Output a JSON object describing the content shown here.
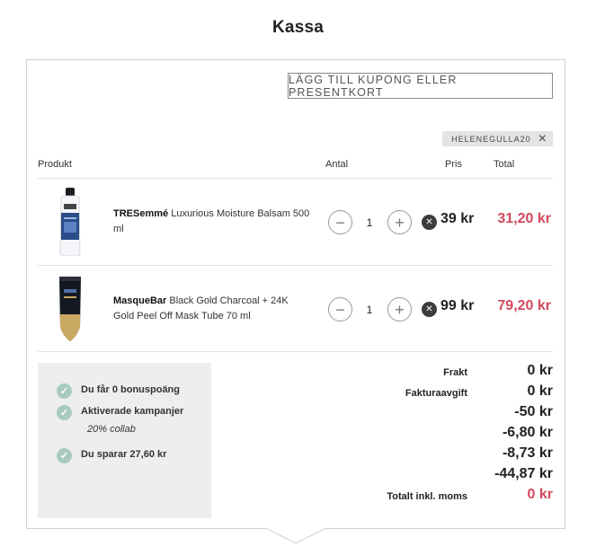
{
  "page": {
    "title": "Kassa"
  },
  "coupon": {
    "button_label": "LÄGG TILL KUPONG ELLER PRESENTKORT",
    "applied_code": "HELENEGULLA20",
    "remove_icon": "close-icon"
  },
  "table": {
    "headers": {
      "product": "Produkt",
      "quantity": "Antal",
      "price": "Pris",
      "total": "Total"
    }
  },
  "items": [
    {
      "brand": "TRESemmé",
      "name": "Luxurious Moisture Balsam 500 ml",
      "quantity": "1",
      "price": "39 kr",
      "total": "31,20 kr",
      "remove_icon": "remove-icon"
    },
    {
      "brand": "MasqueBar",
      "name": "Black Gold Charcoal + 24K Gold Peel Off Mask Tube 70 ml",
      "quantity": "1",
      "price": "99 kr",
      "total": "79,20 kr",
      "remove_icon": "remove-icon"
    }
  ],
  "bonus": {
    "points": "Du får 0 bonuspoäng",
    "campaigns": "Aktiverade kampanjer",
    "campaign_name": "20% collab",
    "savings": "Du sparar 27,60 kr"
  },
  "summary": {
    "shipping_label": "Frakt",
    "shipping_value": "0 kr",
    "invoice_fee_label": "Fakturaavgift",
    "invoice_fee_value": "0 kr",
    "discounts": [
      "-50 kr",
      "-6,80 kr",
      "-8,73 kr",
      "-44,87 kr"
    ],
    "total_label": "Totalt inkl. moms",
    "total_value": "0 kr"
  },
  "colors": {
    "accent_red": "#d24a5c",
    "check_green": "#a9cbbf",
    "bonus_bg": "#eceef0"
  }
}
